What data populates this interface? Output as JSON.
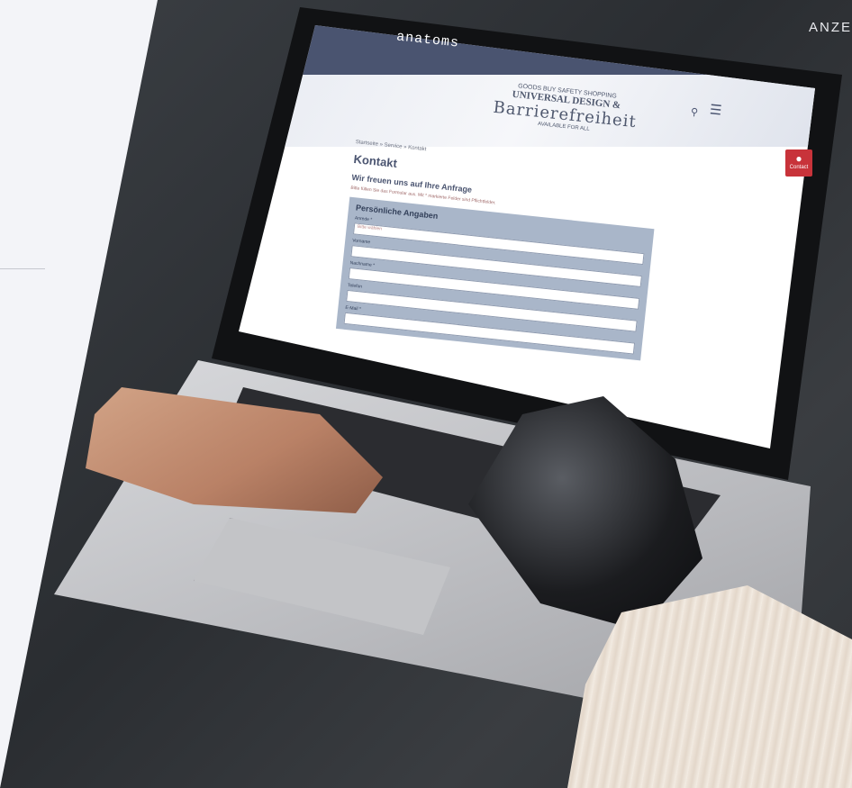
{
  "corner_label": "ANZE",
  "laptop_site": {
    "logo": "anatoms",
    "banner": {
      "top": "GOODS BUY SAFETY SHOPPING",
      "middle": "UNIVERSAL DESIGN &",
      "main": "Barrierefreiheit",
      "bottom": "AVAILABLE FOR ALL"
    },
    "breadcrumb": "Startseite  »  Service  »  Kontakt",
    "page_title": "Kontakt",
    "page_subtitle": "Wir freuen uns auf Ihre Anfrage",
    "intro_text": "Bitte füllen Sie das Formular aus. Mit * markierte Felder sind Pflichtfelder.",
    "form_heading": "Persönliche Angaben",
    "fields": [
      {
        "label": "Anrede *",
        "value": "Bitte wählen"
      },
      {
        "label": "Vorname",
        "value": ""
      },
      {
        "label": "Nachname *",
        "value": ""
      },
      {
        "label": "Telefon",
        "value": ""
      },
      {
        "label": "E-Mail *",
        "value": ""
      }
    ],
    "contact_badge": "Contact"
  }
}
